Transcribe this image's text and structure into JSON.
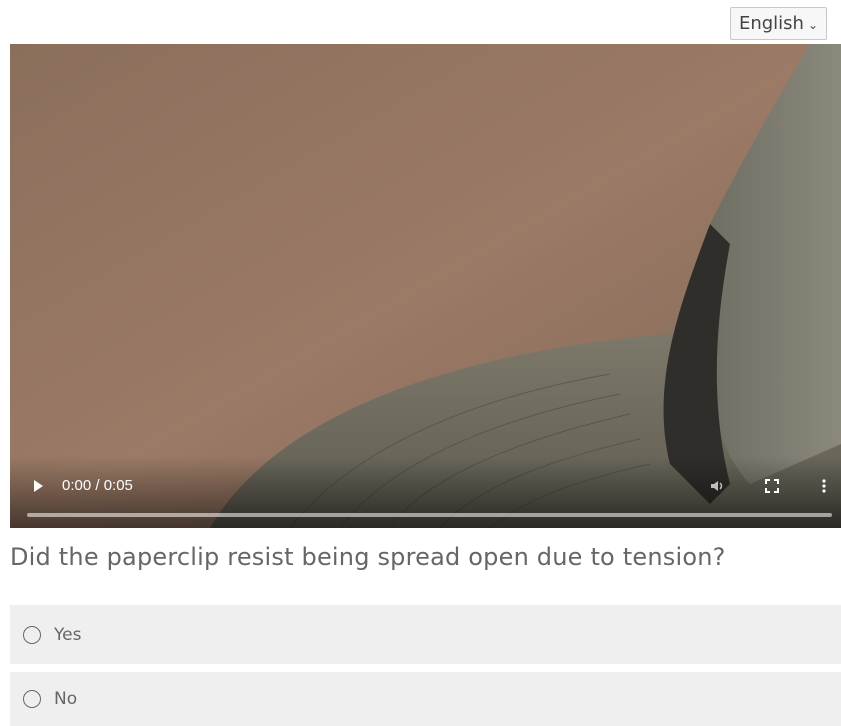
{
  "language_select": {
    "value": "English"
  },
  "video": {
    "time_display": "0:00 / 0:05",
    "progress_fraction": 0
  },
  "question": {
    "text": "Did the paperclip resist being spread open due to tension?",
    "options": [
      {
        "label": "Yes"
      },
      {
        "label": "No"
      }
    ]
  },
  "icons": {
    "play": "play-icon",
    "volume": "volume-icon",
    "fullscreen": "fullscreen-icon",
    "menu": "more-vertical-icon",
    "dropdown": "chevron-down-icon",
    "radio": "radio-unchecked-icon"
  }
}
